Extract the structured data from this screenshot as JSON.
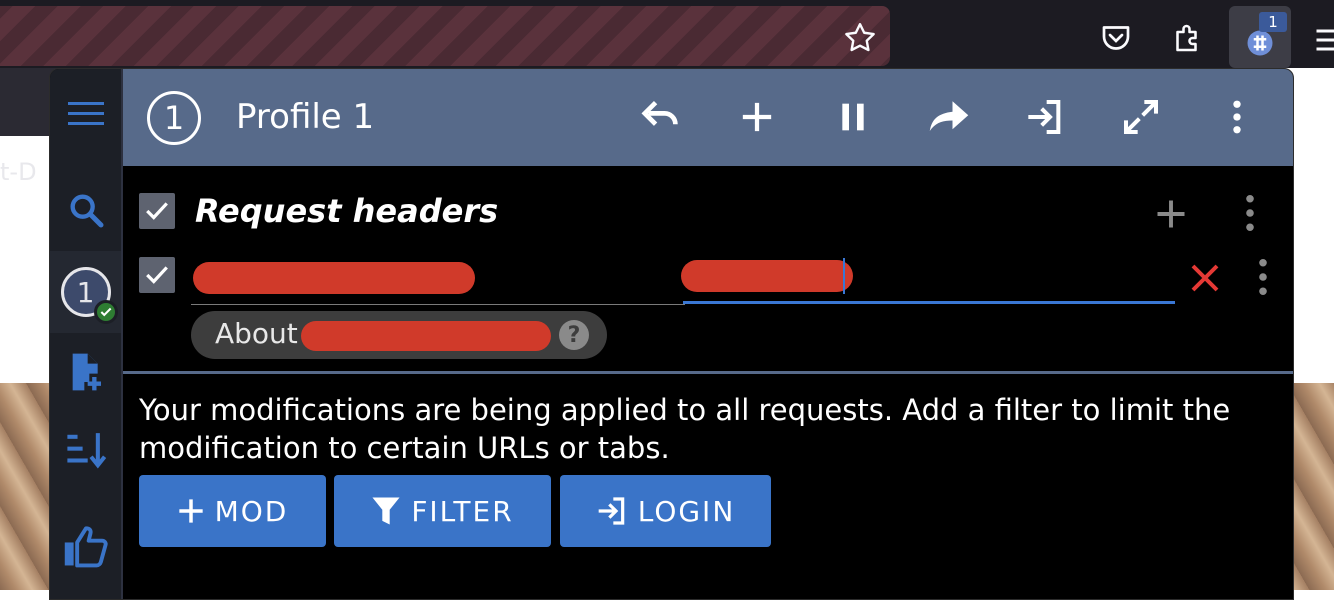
{
  "browser": {
    "tab_text": "t-D",
    "extension_badge": "1"
  },
  "sidebar": {
    "items": [
      {
        "name": "menu",
        "icon": "hamburger-icon"
      },
      {
        "name": "search",
        "icon": "search-icon"
      },
      {
        "name": "profile-1",
        "label": "1",
        "status": "active"
      },
      {
        "name": "add-profile",
        "icon": "file-add-icon"
      },
      {
        "name": "sort",
        "icon": "sort-icon"
      },
      {
        "name": "rate",
        "icon": "thumbs-up-icon"
      }
    ]
  },
  "header": {
    "profile_number": "1",
    "title": "Profile 1",
    "actions": [
      "undo-icon",
      "add-icon",
      "pause-icon",
      "redo-icon",
      "login-icon",
      "fullscreen-icon",
      "more-icon"
    ],
    "color": "#576a8a"
  },
  "request_headers": {
    "title": "Request headers",
    "enabled": true,
    "row": {
      "enabled": true,
      "name": "",
      "value": ""
    },
    "chip_label": "About"
  },
  "notice": {
    "text": "Your modifications are being applied to all requests. Add a filter to limit the modification to certain URLs or tabs."
  },
  "buttons": {
    "mod": "MOD",
    "filter": "FILTER",
    "login": "LOGIN"
  },
  "colors": {
    "accent": "#3a74c8",
    "delete": "#e53935",
    "redaction": "#d03a2a"
  }
}
